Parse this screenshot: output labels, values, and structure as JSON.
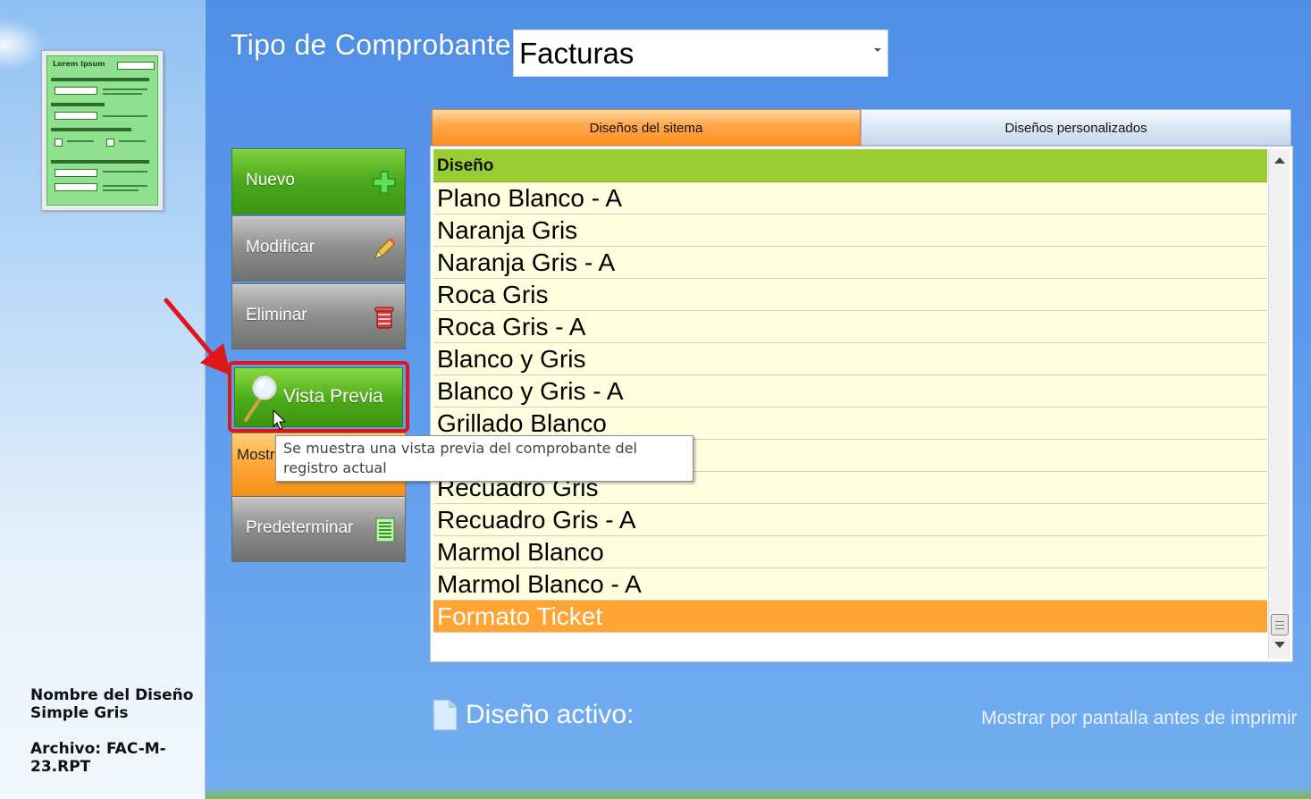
{
  "header": {
    "tipo_label": "Tipo de Comprobante:",
    "tipo_value": "Facturas"
  },
  "thumbnail": {
    "title": "Lorem Ipsum"
  },
  "actions": {
    "nuevo": "Nuevo",
    "modificar": "Modificar",
    "eliminar": "Eliminar",
    "vista_previa": "Vista Previa",
    "mostrar": "Mostrar",
    "predeterminar": "Predeterminar"
  },
  "tooltip": {
    "text": "Se muestra una vista previa del comprobante del registro actual"
  },
  "tabs": [
    {
      "label": "Diseños del sitema",
      "active": true
    },
    {
      "label": "Diseños personalizados",
      "active": false
    }
  ],
  "grid": {
    "column_header": "Diseño",
    "rows": [
      "Plano Blanco - A",
      "Naranja Gris",
      "Naranja Gris - A",
      "Roca Gris",
      "Roca Gris - A",
      "Blanco y Gris",
      "Blanco y Gris - A",
      "Grillado Blanco",
      "",
      "Recuadro Gris",
      "Recuadro Gris - A",
      "Marmol Blanco",
      "Marmol Blanco - A",
      "Formato Ticket"
    ],
    "selected_index": 13
  },
  "info": {
    "design_name": "Nombre del Diseño Simple Gris",
    "file": "Archivo: FAC-M-23.RPT"
  },
  "footer": {
    "active_design_label": "Diseño activo:",
    "show_before_print": "Mostrar por pantalla antes de imprimir"
  },
  "colors": {
    "accent_green": "#4ba81b",
    "accent_orange": "#ffa333",
    "row_background": "#ffffe0",
    "highlight_red": "#e0151a"
  }
}
